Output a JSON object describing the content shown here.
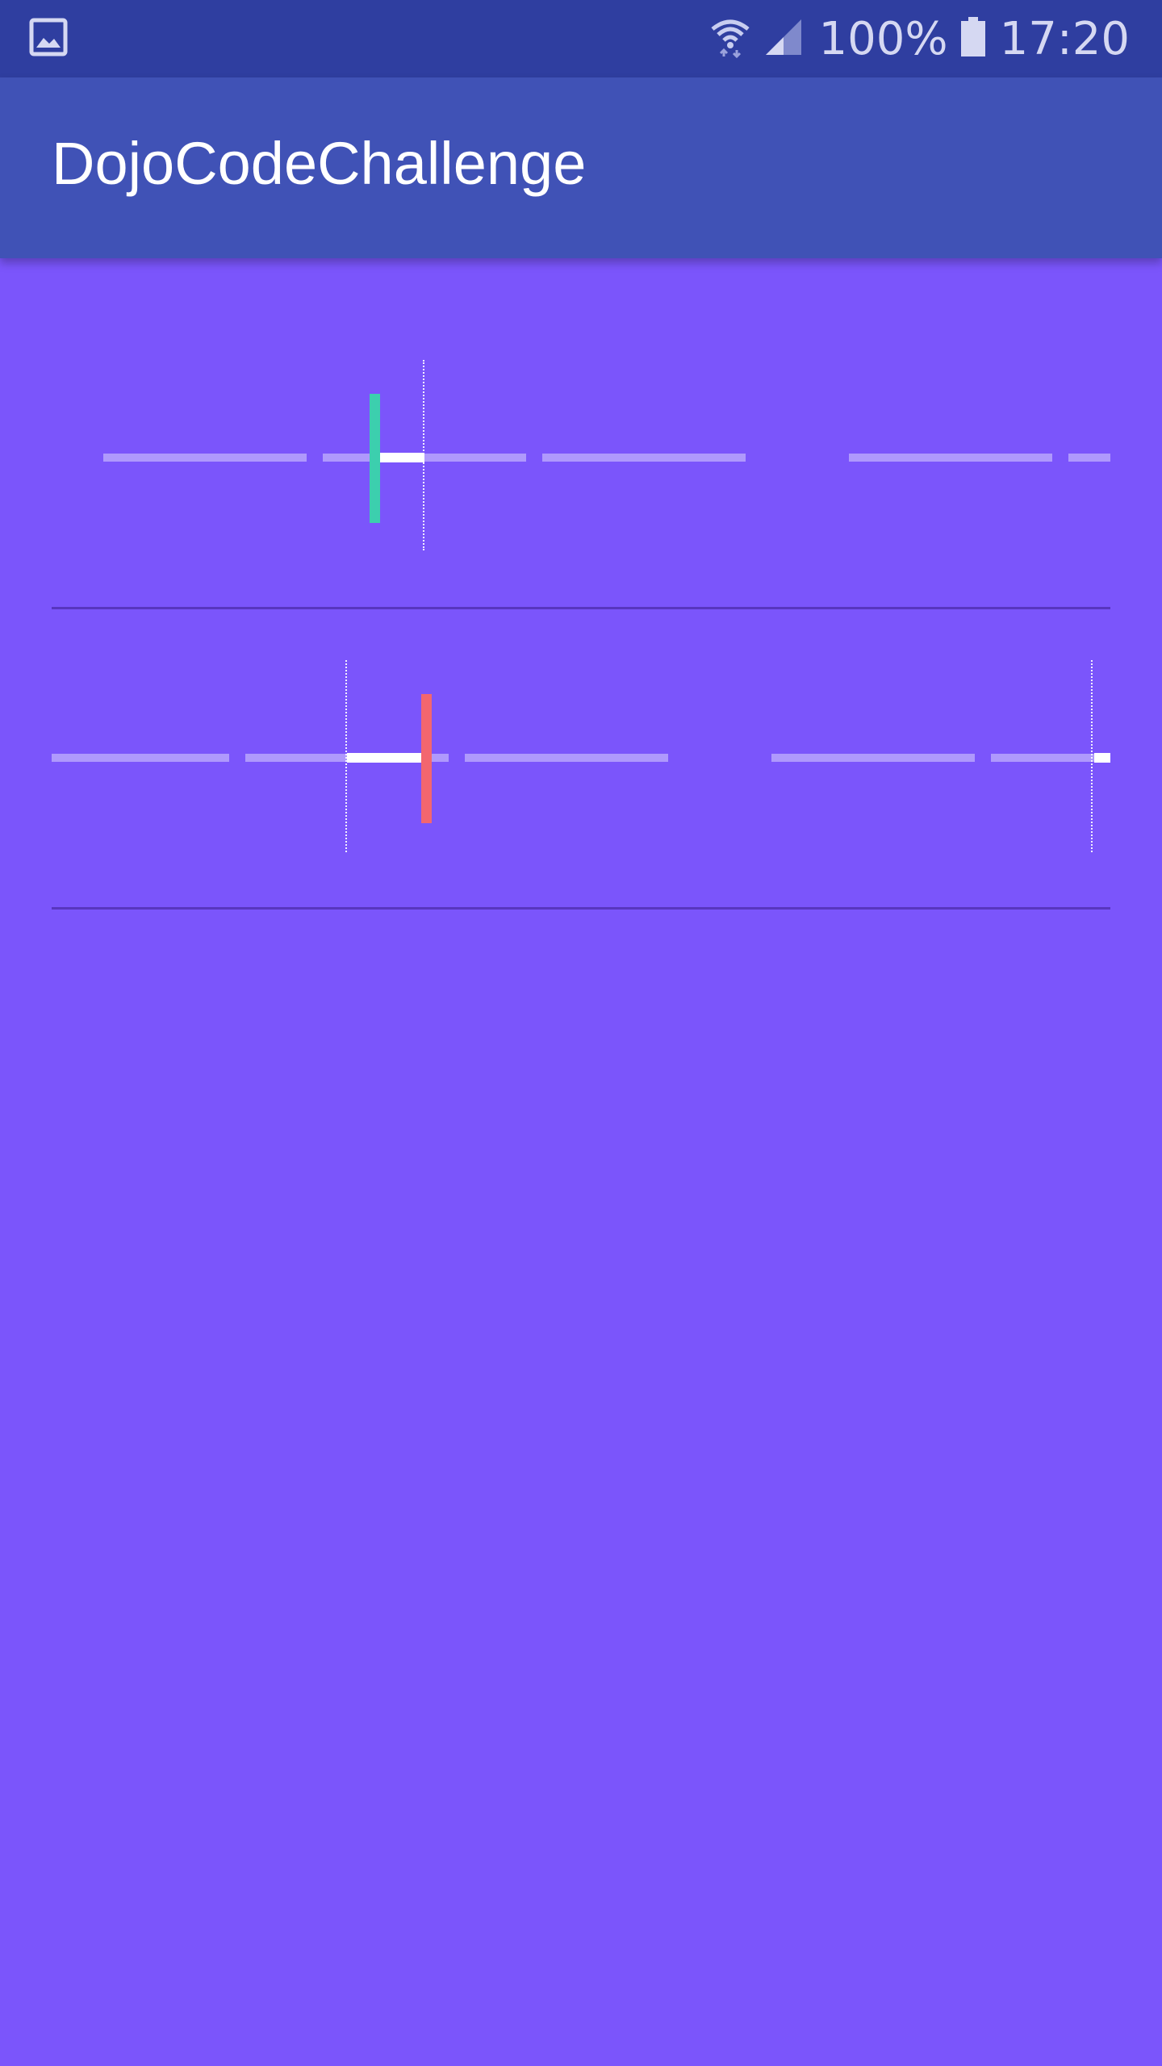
{
  "status_bar": {
    "left_icon": "image-icon",
    "wifi_icon": "wifi-icon",
    "signal_icon": "cell-signal-icon",
    "battery_percent": "100%",
    "battery_icon": "battery-icon",
    "clock": "17:20"
  },
  "app_bar": {
    "title": "DojoCodeChallenge"
  },
  "colors": {
    "background": "#7b55fb",
    "status_bar": "#2f3ea0",
    "app_bar": "#4052b6",
    "cursor_row_1": "#3ccfae",
    "cursor_row_2": "#f3666f"
  }
}
